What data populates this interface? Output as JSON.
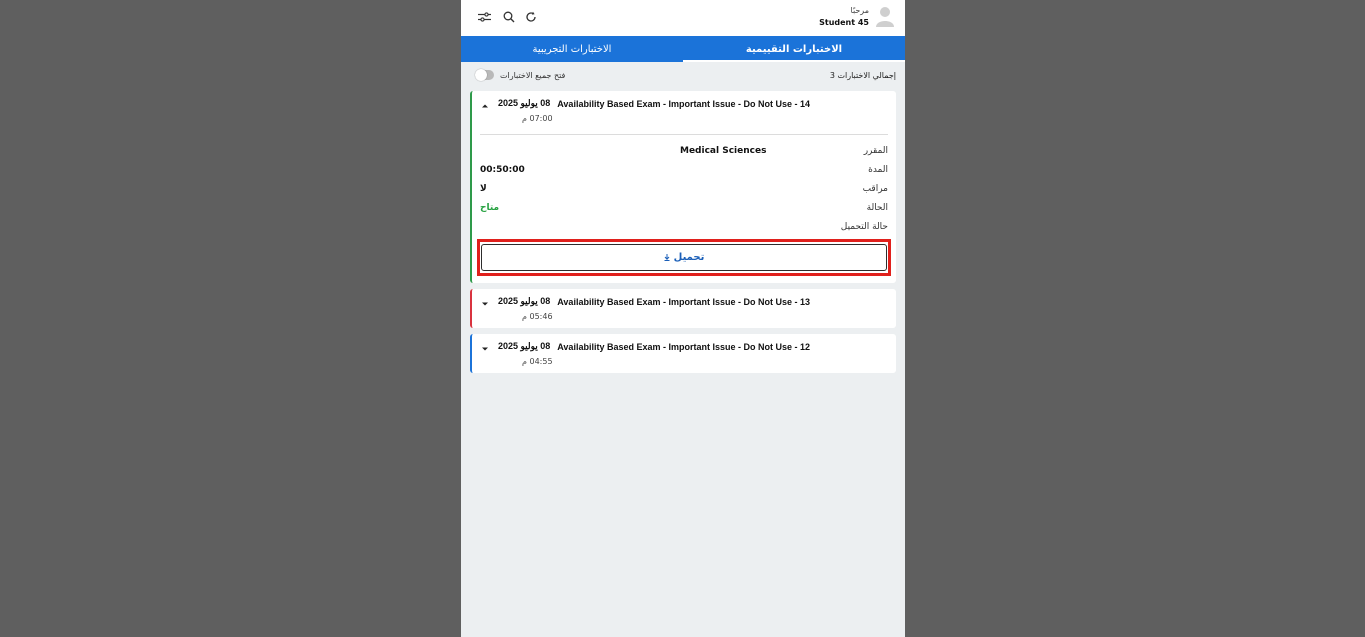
{
  "header": {
    "greeting": "مرحبًا",
    "student_name": "Student 45",
    "icons": [
      "avatar-icon",
      "refresh-icon",
      "search-icon",
      "filter-icon"
    ]
  },
  "tabs": [
    {
      "label": "الاختبارات التقييمية",
      "active": true
    },
    {
      "label": "الاختبارات التجريبية",
      "active": false
    }
  ],
  "summary": {
    "total_label": "إجمالي الاختبارات 3",
    "open_all_label": "فتح جميع الاختبارات",
    "open_all_enabled": false
  },
  "exams": [
    {
      "title": "Availability Based Exam - Important Issue - Do Not Use - 14",
      "date": "08 يوليو 2025",
      "time": "07:00 م",
      "expanded": true,
      "accent": "#2e9a4a",
      "details": {
        "course_label": "المقرر",
        "course_value": "Medical Sciences",
        "duration_label": "المدة",
        "duration_value": "00:50:00",
        "proctored_label": "مراقب",
        "proctored_value": "لا",
        "status_label": "الحالة",
        "status_value": "متاح",
        "download_status_label": "حالة التحميل"
      },
      "download_label": "تحميل"
    },
    {
      "title": "Availability Based Exam - Important Issue - Do Not Use - 13",
      "date": "08 يوليو 2025",
      "time": "05:46 م",
      "expanded": false,
      "accent": "#d9333f"
    },
    {
      "title": "Availability Based Exam - Important Issue - Do Not Use - 12",
      "date": "08 يوليو 2025",
      "time": "04:55 م",
      "expanded": false,
      "accent": "#1b73d9"
    }
  ],
  "colors": {
    "primary": "#1b73d9",
    "available": "#27a241",
    "highlight": "#e0201c"
  }
}
